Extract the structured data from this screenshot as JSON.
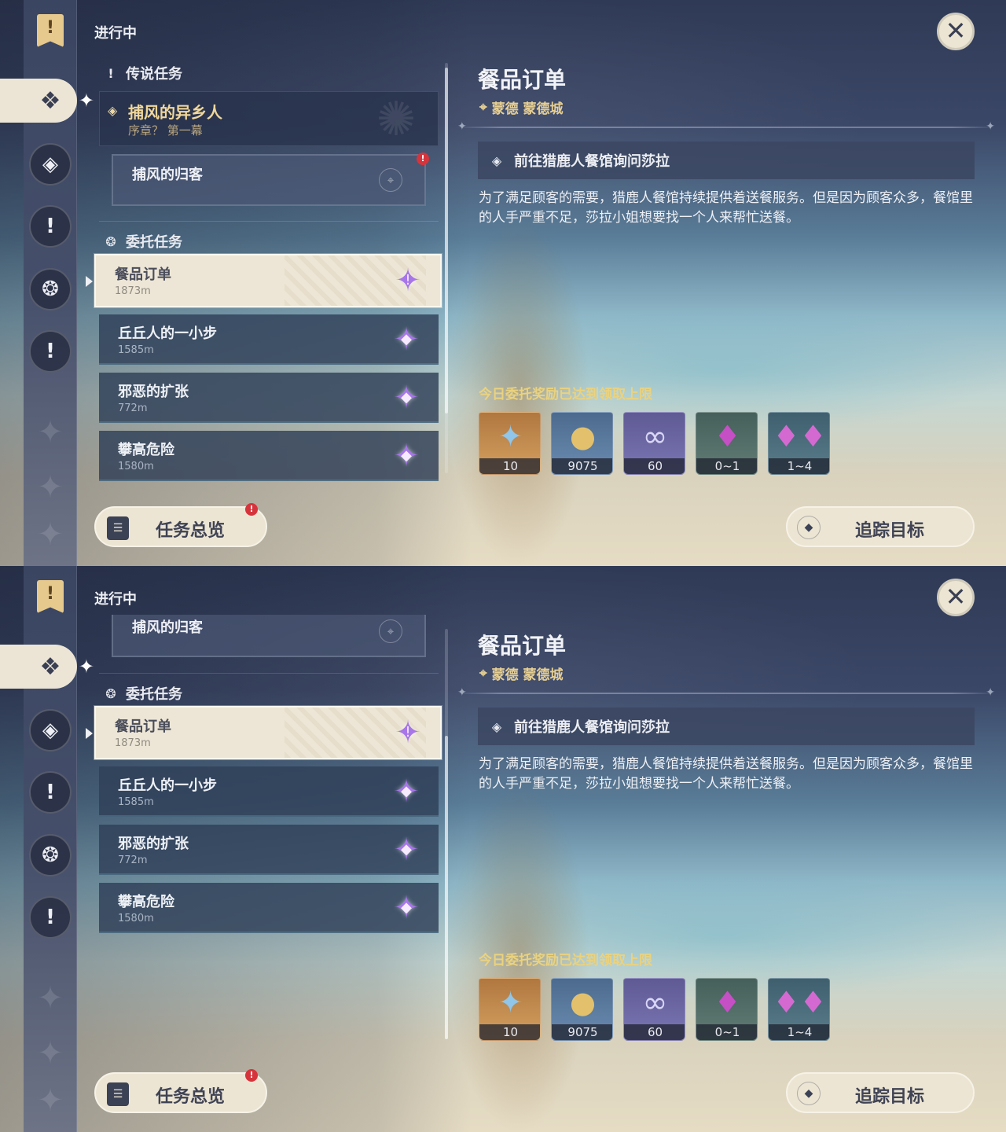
{
  "colors": {
    "accent_gold": "#e7cf93",
    "reward_limit_yellow": "#ead27f",
    "commission_star": "#a776e8",
    "alert_red": "#d6343c",
    "active_card": "#ede6d6"
  },
  "rail": {
    "flag_icon": "quest-journal-icon",
    "flag_glyph": "!",
    "active_tab_icon": "commission-icon",
    "buttons": [
      "legend-icon",
      "exclamation-icon",
      "commission-diamond-icon",
      "exclamation-icon"
    ]
  },
  "header": {
    "in_progress": "进行中"
  },
  "legend_section": {
    "title": "传说任务",
    "quest_name": "捕风的异乡人",
    "quest_chapter": "序章？ 第一幕",
    "sub_quest": "捕风的归客",
    "alert_badge": "!"
  },
  "commission_section": {
    "title": "委托任务",
    "items": [
      {
        "name": "餐品订单",
        "distance": "1873m"
      },
      {
        "name": "丘丘人的一小步",
        "distance": "1585m"
      },
      {
        "name": "邪恶的扩张",
        "distance": "772m"
      },
      {
        "name": "攀高危险",
        "distance": "1580m"
      }
    ]
  },
  "buttons": {
    "overview": "任务总览",
    "overview_badge": "!",
    "track": "追踪目标",
    "close": "✕"
  },
  "detail": {
    "title": "餐品订单",
    "location": "蒙德 蒙德城",
    "objective": "前往猎鹿人餐馆询问莎拉",
    "description": "为了满足顾客的需要，猎鹿人餐馆持续提供着送餐服务。但是因为顾客众多，餐馆里的人手严重不足，莎拉小姐想要找一个人来帮忙送餐。",
    "reward_limit": "今日委托奖励已达到领取上限",
    "rewards": [
      {
        "icon": "primogem-icon",
        "count": "10"
      },
      {
        "icon": "mora-icon",
        "count": "9075"
      },
      {
        "icon": "friendship-exp-icon",
        "count": "60"
      },
      {
        "icon": "crystal-ore-icon",
        "count": "0~1"
      },
      {
        "icon": "crystal-cluster-icon",
        "count": "1~4"
      }
    ]
  }
}
